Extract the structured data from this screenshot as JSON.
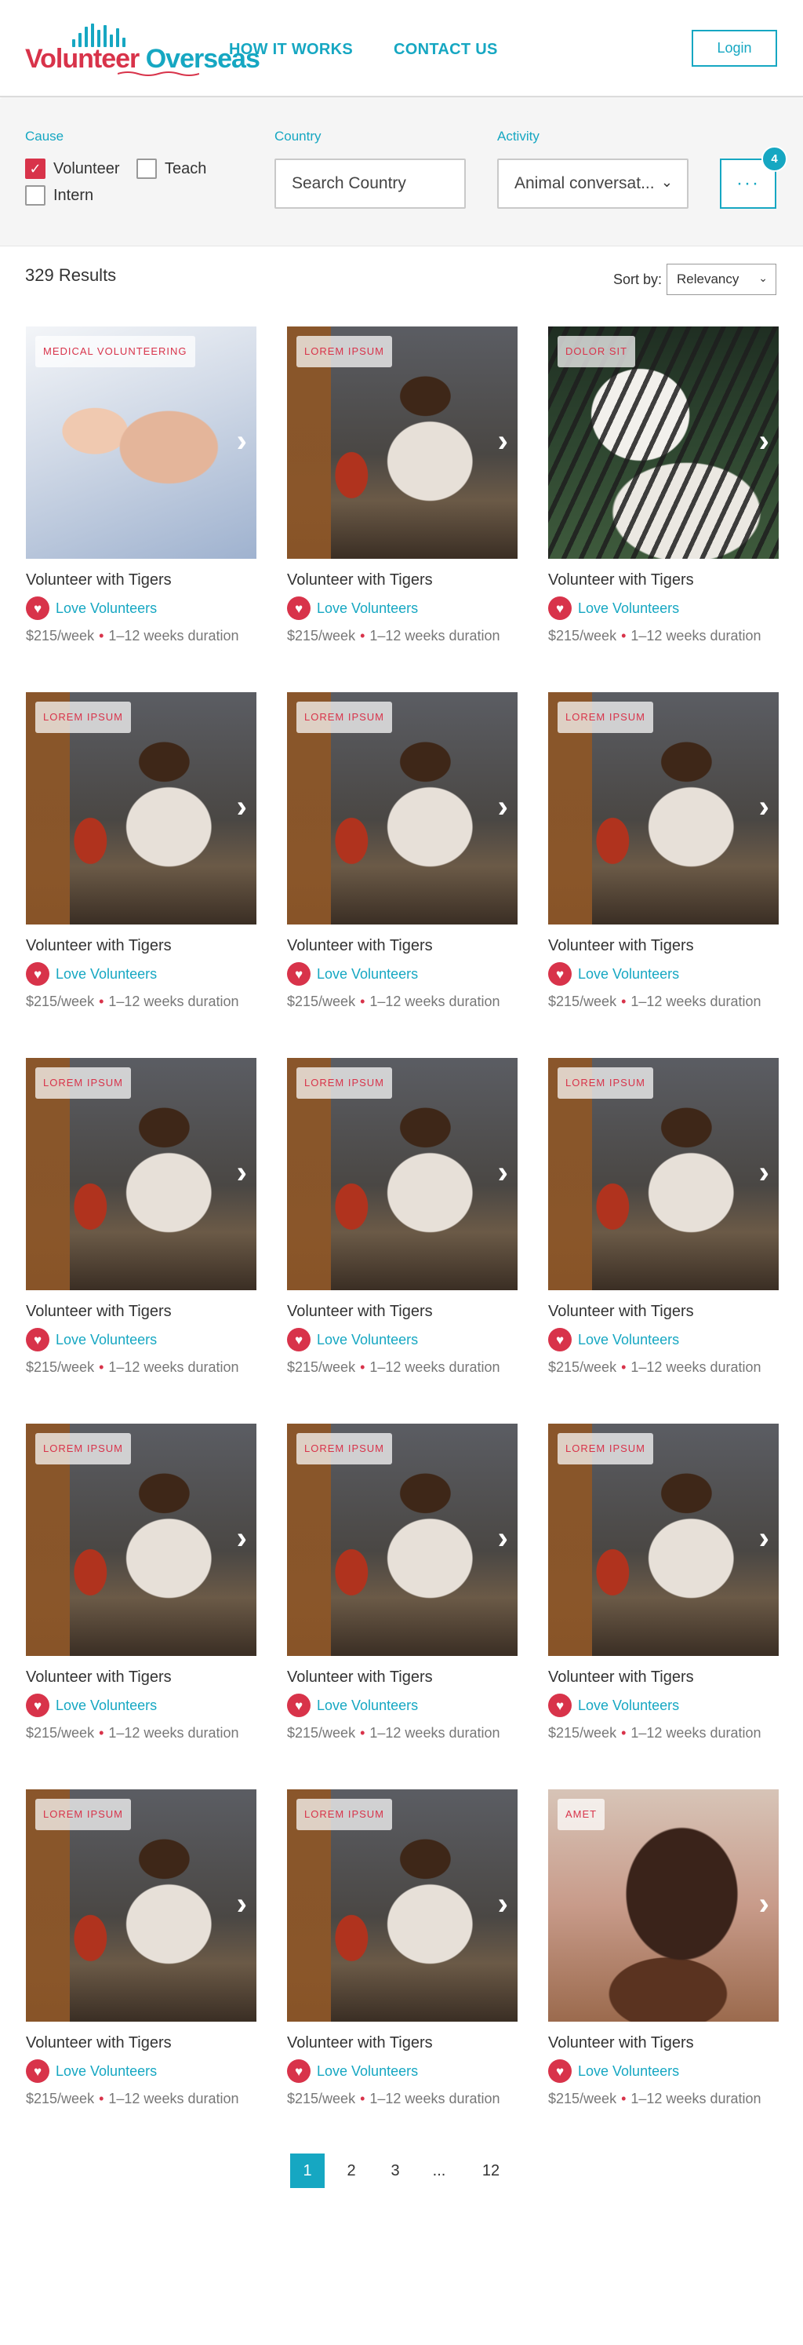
{
  "header": {
    "logo_word1": "Volunteer",
    "logo_word2": "Overseas",
    "nav": [
      "HOW IT WORKS",
      "CONTACT US"
    ],
    "login_label": "Login"
  },
  "filters": {
    "cause_label": "Cause",
    "cause_options": [
      {
        "label": "Volunteer",
        "checked": true
      },
      {
        "label": "Teach",
        "checked": false
      },
      {
        "label": "Intern",
        "checked": false
      }
    ],
    "country_label": "Country",
    "country_placeholder": "Search Country",
    "activity_label": "Activity",
    "activity_value": "Animal conversat...",
    "more_label": "···",
    "more_count": "4"
  },
  "results": {
    "count_text": "329 Results",
    "sort_label": "Sort by:",
    "sort_value": "Relevancy"
  },
  "cards": [
    {
      "tag": "MEDICAL VOLUNTEERING",
      "image": "hands",
      "title": "Volunteer with Tigers",
      "org": "Love Volunteers",
      "price": "$215/week",
      "duration": "1–12 weeks duration"
    },
    {
      "tag": "LOREM IPSUM",
      "image": "child",
      "title": "Volunteer with Tigers",
      "org": "Love Volunteers",
      "price": "$215/week",
      "duration": "1–12 weeks duration"
    },
    {
      "tag": "DOLOR SIT",
      "image": "tiger",
      "title": "Volunteer with Tigers",
      "org": "Love Volunteers",
      "price": "$215/week",
      "duration": "1–12 weeks duration"
    },
    {
      "tag": "LOREM IPSUM",
      "image": "child",
      "title": "Volunteer with Tigers",
      "org": "Love Volunteers",
      "price": "$215/week",
      "duration": "1–12 weeks duration"
    },
    {
      "tag": "LOREM IPSUM",
      "image": "child",
      "title": "Volunteer with Tigers",
      "org": "Love Volunteers",
      "price": "$215/week",
      "duration": "1–12 weeks duration"
    },
    {
      "tag": "LOREM IPSUM",
      "image": "child",
      "title": "Volunteer with Tigers",
      "org": "Love Volunteers",
      "price": "$215/week",
      "duration": "1–12 weeks duration"
    },
    {
      "tag": "LOREM IPSUM",
      "image": "child",
      "title": "Volunteer with Tigers",
      "org": "Love Volunteers",
      "price": "$215/week",
      "duration": "1–12 weeks duration"
    },
    {
      "tag": "LOREM IPSUM",
      "image": "child",
      "title": "Volunteer with Tigers",
      "org": "Love Volunteers",
      "price": "$215/week",
      "duration": "1–12 weeks duration"
    },
    {
      "tag": "LOREM IPSUM",
      "image": "child",
      "title": "Volunteer with Tigers",
      "org": "Love Volunteers",
      "price": "$215/week",
      "duration": "1–12 weeks duration"
    },
    {
      "tag": "LOREM IPSUM",
      "image": "child",
      "title": "Volunteer with Tigers",
      "org": "Love Volunteers",
      "price": "$215/week",
      "duration": "1–12 weeks duration"
    },
    {
      "tag": "LOREM IPSUM",
      "image": "child",
      "title": "Volunteer with Tigers",
      "org": "Love Volunteers",
      "price": "$215/week",
      "duration": "1–12 weeks duration"
    },
    {
      "tag": "LOREM IPSUM",
      "image": "child",
      "title": "Volunteer with Tigers",
      "org": "Love Volunteers",
      "price": "$215/week",
      "duration": "1–12 weeks duration"
    },
    {
      "tag": "LOREM IPSUM",
      "image": "child",
      "title": "Volunteer with Tigers",
      "org": "Love Volunteers",
      "price": "$215/week",
      "duration": "1–12 weeks duration"
    },
    {
      "tag": "LOREM IPSUM",
      "image": "child",
      "title": "Volunteer with Tigers",
      "org": "Love Volunteers",
      "price": "$215/week",
      "duration": "1–12 weeks duration"
    },
    {
      "tag": "AMET",
      "image": "boy",
      "title": "Volunteer with Tigers",
      "org": "Love Volunteers",
      "price": "$215/week",
      "duration": "1–12 weeks duration"
    }
  ],
  "pagination": {
    "pages": [
      "1",
      "2",
      "3",
      "...",
      "12"
    ],
    "current": "1"
  },
  "icons": {
    "card_arrow": "chevron-right-icon",
    "org_logo": "heart-icon",
    "dropdown": "chevron-down-icon",
    "check": "checkmark-icon"
  },
  "colors": {
    "accent": "#16a7c2",
    "brand_red": "#d8334a"
  }
}
